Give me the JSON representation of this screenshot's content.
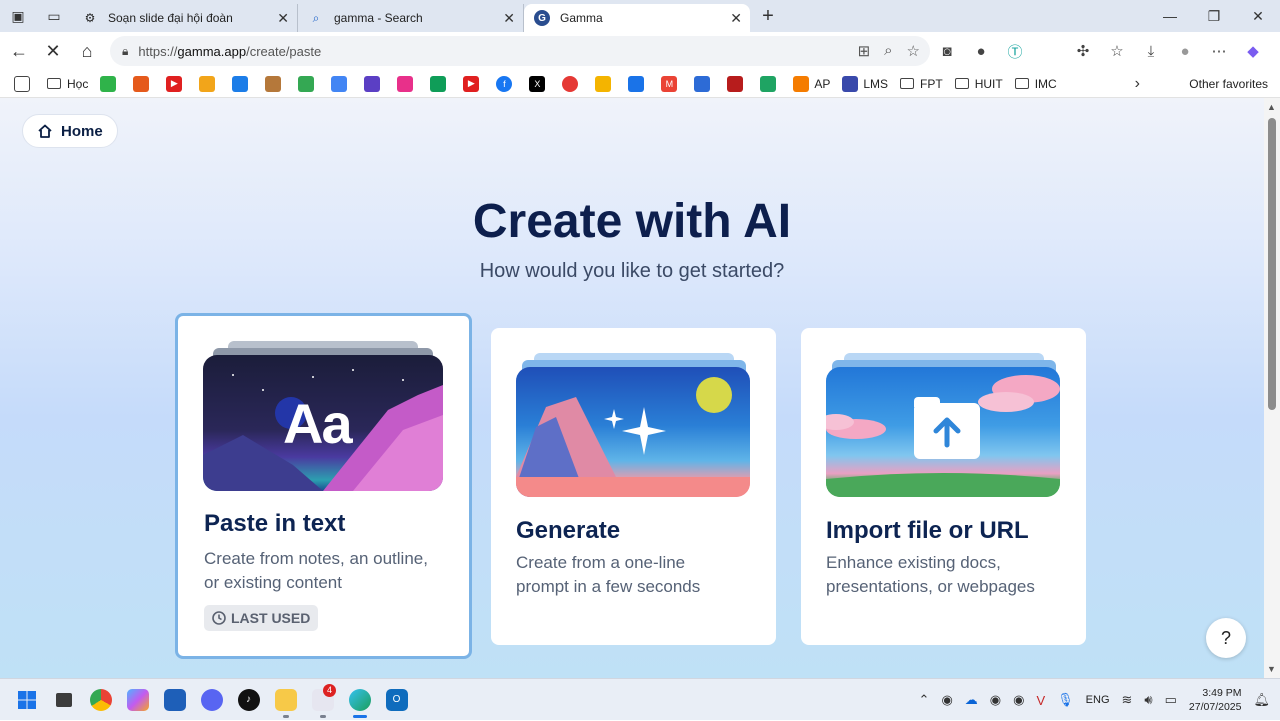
{
  "browser": {
    "tabs": [
      {
        "label": "Soạn slide đại hội đoàn",
        "active": false
      },
      {
        "label": "gamma - Search",
        "active": false
      },
      {
        "label": "Gamma",
        "active": true
      }
    ],
    "url_prefix": "https://",
    "url_domain": "gamma.app",
    "url_path": "/create/paste"
  },
  "bookmarks": {
    "items": [
      "Học",
      "AP",
      "LMS",
      "FPT",
      "HUIT",
      "IMC"
    ],
    "other": "Other favorites"
  },
  "page": {
    "home_label": "Home",
    "title": "Create with AI",
    "subtitle": "How would you like to get started?",
    "cards": [
      {
        "title": "Paste in text",
        "desc1": "Create from notes, an outline,",
        "desc2": "or existing content",
        "badge": "LAST USED",
        "thumb_text": "Aa"
      },
      {
        "title": "Generate",
        "desc1": "Create from a one-line",
        "desc2": "prompt in a few seconds"
      },
      {
        "title": "Import file or URL",
        "desc1": "Enhance existing docs,",
        "desc2": "presentations, or webpages"
      }
    ],
    "help_label": "?"
  },
  "taskbar": {
    "notif_count": "4",
    "lang": "ENG",
    "time": "3:49 PM",
    "date": "27/07/2025"
  }
}
